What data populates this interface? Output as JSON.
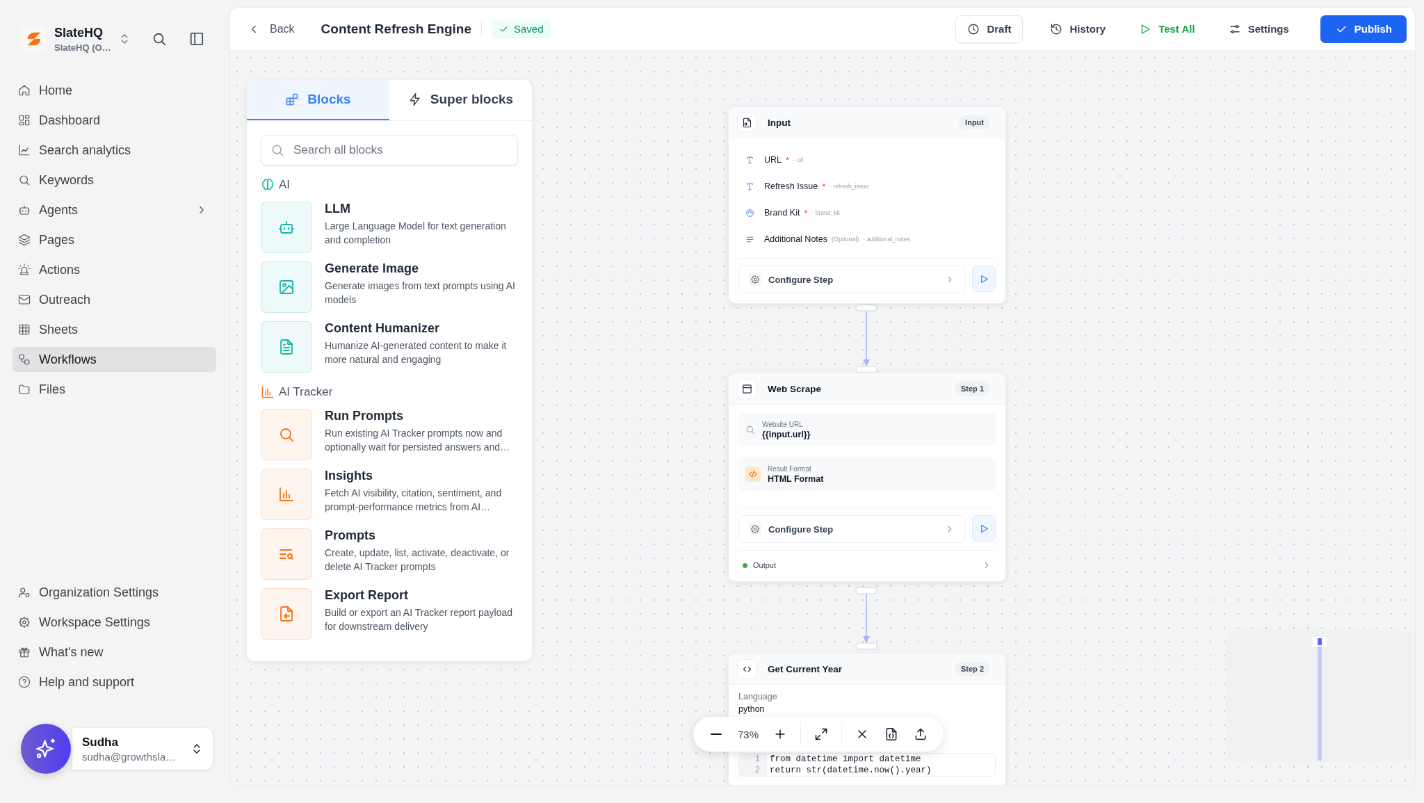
{
  "workspace": {
    "name": "SlateHQ",
    "subtitle": "SlateHQ (O…"
  },
  "nav": [
    {
      "label": "Home",
      "kind": "link",
      "selected": false
    },
    {
      "label": "Dashboard",
      "kind": "link",
      "selected": false
    },
    {
      "label": "Search analytics",
      "kind": "link",
      "selected": false
    },
    {
      "label": "Keywords",
      "kind": "link",
      "selected": false
    },
    {
      "label": "Agents",
      "kind": "group",
      "selected": false
    },
    {
      "label": "Pages",
      "kind": "link",
      "selected": false
    },
    {
      "label": "Actions",
      "kind": "link",
      "selected": false
    },
    {
      "label": "Outreach",
      "kind": "link",
      "selected": false
    },
    {
      "label": "Sheets",
      "kind": "link",
      "selected": false
    },
    {
      "label": "Workflows",
      "kind": "link",
      "selected": true
    },
    {
      "label": "Files",
      "kind": "link",
      "selected": false
    }
  ],
  "footer_nav": [
    "Organization Settings",
    "Workspace Settings",
    "What's new",
    "Help and support"
  ],
  "user": {
    "name": "Sudha",
    "email": "sudha@growthsla…"
  },
  "header": {
    "back": "Back",
    "title": "Content Refresh Engine",
    "status": "Saved",
    "actions": [
      {
        "label": "Draft",
        "kind": "outlined"
      },
      {
        "label": "History",
        "kind": "plain"
      },
      {
        "label": "Test All",
        "kind": "success"
      },
      {
        "label": "Settings",
        "kind": "plain"
      },
      {
        "label": "Publish",
        "kind": "primary"
      }
    ]
  },
  "blocks_panel": {
    "tabs": [
      {
        "label": "Blocks",
        "selected": true
      },
      {
        "label": "Super blocks",
        "selected": false
      }
    ],
    "search": {
      "placeholder": "Search all blocks"
    },
    "groups": [
      {
        "title": "AI",
        "color": "#14b8a6",
        "items": [
          {
            "name": "LLM",
            "description": "Large Language Model for text generation and completion"
          },
          {
            "name": "Generate Image",
            "description": "Generate images from text prompts using AI models"
          },
          {
            "name": "Content Humanizer",
            "description": "Humanize AI-generated content to make it more natural and engaging"
          }
        ]
      },
      {
        "title": "AI Tracker",
        "color": "#f97316",
        "items": [
          {
            "name": "Run Prompts",
            "description": "Run existing AI Tracker prompts now and optionally wait for persisted answers and…"
          },
          {
            "name": "Insights",
            "description": "Fetch AI visibility, citation, sentiment, and prompt-performance metrics from AI…"
          },
          {
            "name": "Prompts",
            "description": "Create, update, list, activate, deactivate, or delete AI Tracker prompts"
          },
          {
            "name": "Export Report",
            "description": "Build or export an AI Tracker report payload for downstream delivery"
          }
        ]
      }
    ]
  },
  "nodes": [
    {
      "kind": "input",
      "title": "Input",
      "badge": "Input",
      "configure": "Configure Step",
      "fields": [
        {
          "label": "URL",
          "required_mark": "*",
          "key": "· url"
        },
        {
          "label": "Refresh Issue",
          "required_mark": "*",
          "key": "· refresh_issue"
        },
        {
          "label": "Brand Kit",
          "required_mark": "*",
          "key": "· brand_kit"
        },
        {
          "label": "Additional Notes",
          "optional_label": "(Optional)",
          "key": "· additional_notes"
        }
      ]
    },
    {
      "kind": "scrape",
      "title": "Web Scrape",
      "badge": "Step 1",
      "configure": "Configure Step",
      "output": "Output",
      "settings": [
        {
          "label": "Website URL",
          "value": "{{input.url}}"
        },
        {
          "label": "Result Format",
          "value": "HTML Format"
        }
      ]
    },
    {
      "kind": "code",
      "title": "Get Current Year",
      "badge": "Step 2",
      "language_label": "Language",
      "language": "python",
      "code": [
        {
          "number": "1",
          "text": "from datetime import datetime"
        },
        {
          "number": "2",
          "text": "return str(datetime.now().year)"
        }
      ]
    }
  ],
  "zoom": "73%"
}
